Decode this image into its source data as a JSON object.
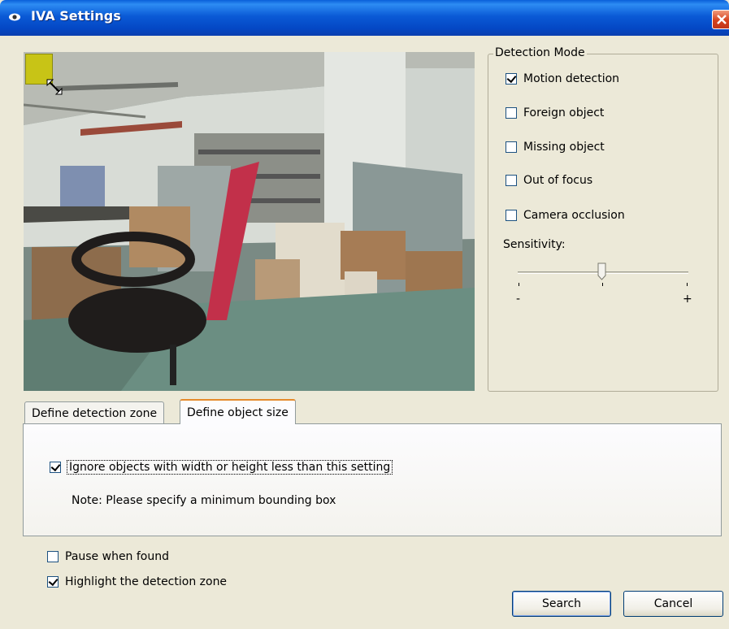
{
  "window": {
    "title": "IVA Settings"
  },
  "detection_mode": {
    "legend": "Detection Mode",
    "options": [
      {
        "label": "Motion detection",
        "checked": true
      },
      {
        "label": "Foreign object",
        "checked": false
      },
      {
        "label": "Missing object",
        "checked": false
      },
      {
        "label": "Out of focus",
        "checked": false
      },
      {
        "label": "Camera occlusion",
        "checked": false
      }
    ],
    "sensitivity_label": "Sensitivity:",
    "sensitivity_value": 0.5,
    "min_label": "-",
    "max_label": "+"
  },
  "tabs": [
    {
      "label": "Define detection zone",
      "active": false
    },
    {
      "label": "Define object size",
      "active": true
    }
  ],
  "object_size": {
    "ignore_label": "Ignore objects with width or height less than this setting",
    "ignore_checked": true,
    "note": "Note: Please specify a minimum bounding box"
  },
  "options": {
    "pause_label": "Pause when found",
    "pause_checked": false,
    "highlight_label": "Highlight the detection zone",
    "highlight_checked": true
  },
  "buttons": {
    "search": "Search",
    "cancel": "Cancel"
  }
}
